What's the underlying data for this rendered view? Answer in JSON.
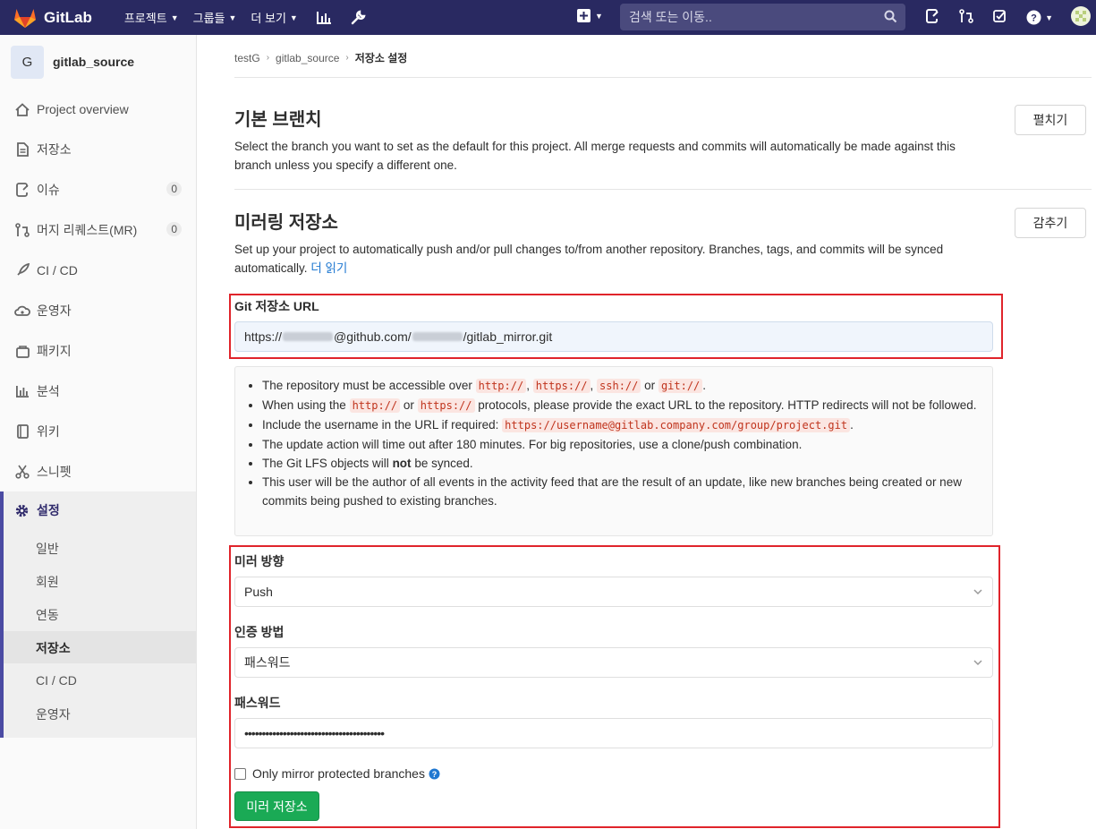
{
  "topbar": {
    "brand": "GitLab",
    "nav": [
      "프로젝트",
      "그룹들",
      "더 보기"
    ],
    "search_placeholder": "검색 또는 이동.."
  },
  "sidebar": {
    "project_avatar": "G",
    "project_name": "gitlab_source",
    "items": [
      {
        "label": "Project overview",
        "icon": "home-icon"
      },
      {
        "label": "저장소",
        "icon": "document-icon"
      },
      {
        "label": "이슈",
        "icon": "issues-icon",
        "badge": "0"
      },
      {
        "label": "머지 리퀘스트(MR)",
        "icon": "merge-request-icon",
        "badge": "0"
      },
      {
        "label": "CI / CD",
        "icon": "rocket-icon"
      },
      {
        "label": "운영자",
        "icon": "cloud-gear-icon"
      },
      {
        "label": "패키지",
        "icon": "package-icon"
      },
      {
        "label": "분석",
        "icon": "chart-icon"
      },
      {
        "label": "위키",
        "icon": "book-icon"
      },
      {
        "label": "스니펫",
        "icon": "scissors-icon"
      }
    ],
    "settings": {
      "label": "설정",
      "sub": [
        "일반",
        "회원",
        "연동",
        "저장소",
        "CI / CD",
        "운영자"
      ],
      "active": "저장소"
    }
  },
  "breadcrumb": [
    "testG",
    "gitlab_source",
    "저장소 설정"
  ],
  "default_branch": {
    "title": "기본 브랜치",
    "description": "Select the branch you want to set as the default for this project. All merge requests and commits will automatically be made against this branch unless you specify a different one.",
    "button": "펼치기"
  },
  "mirroring": {
    "title": "미러링 저장소",
    "description": "Set up your project to automatically push and/or pull changes to/from another repository. Branches, tags, and commits will be synced automatically.",
    "read_more": "더 읽기",
    "button": "감추기",
    "url_label": "Git 저장소 URL",
    "url_prefix": "https://",
    "url_middle": "@github.com/",
    "url_suffix": "/gitlab_mirror.git",
    "info": {
      "line1_pre": "The repository must be accessible over",
      "protocols": [
        "http://",
        "https://",
        "ssh://",
        "git://"
      ],
      "or": "or",
      "line2_pre": "When using the",
      "line2_post": "protocols, please provide the exact URL to the repository. HTTP redirects will not be followed.",
      "line3_pre": "Include the username in the URL if required:",
      "line3_code": "https://username@gitlab.company.com/group/project.git",
      "line4": "The update action will time out after 180 minutes. For big repositories, use a clone/push combination.",
      "line5_pre": "The Git LFS objects will",
      "line5_bold": "not",
      "line5_post": "be synced.",
      "line6": "This user will be the author of all events in the activity feed that are the result of an update, like new branches being created or new commits being pushed to existing branches."
    },
    "direction_label": "미러 방향",
    "direction_value": "Push",
    "auth_label": "인증 방법",
    "auth_value": "패스워드",
    "password_label": "패스워드",
    "password_value": "••••••••••••••••••••••••••••••••••••••••",
    "protected_label": "Only mirror protected branches",
    "submit": "미러 저장소"
  }
}
